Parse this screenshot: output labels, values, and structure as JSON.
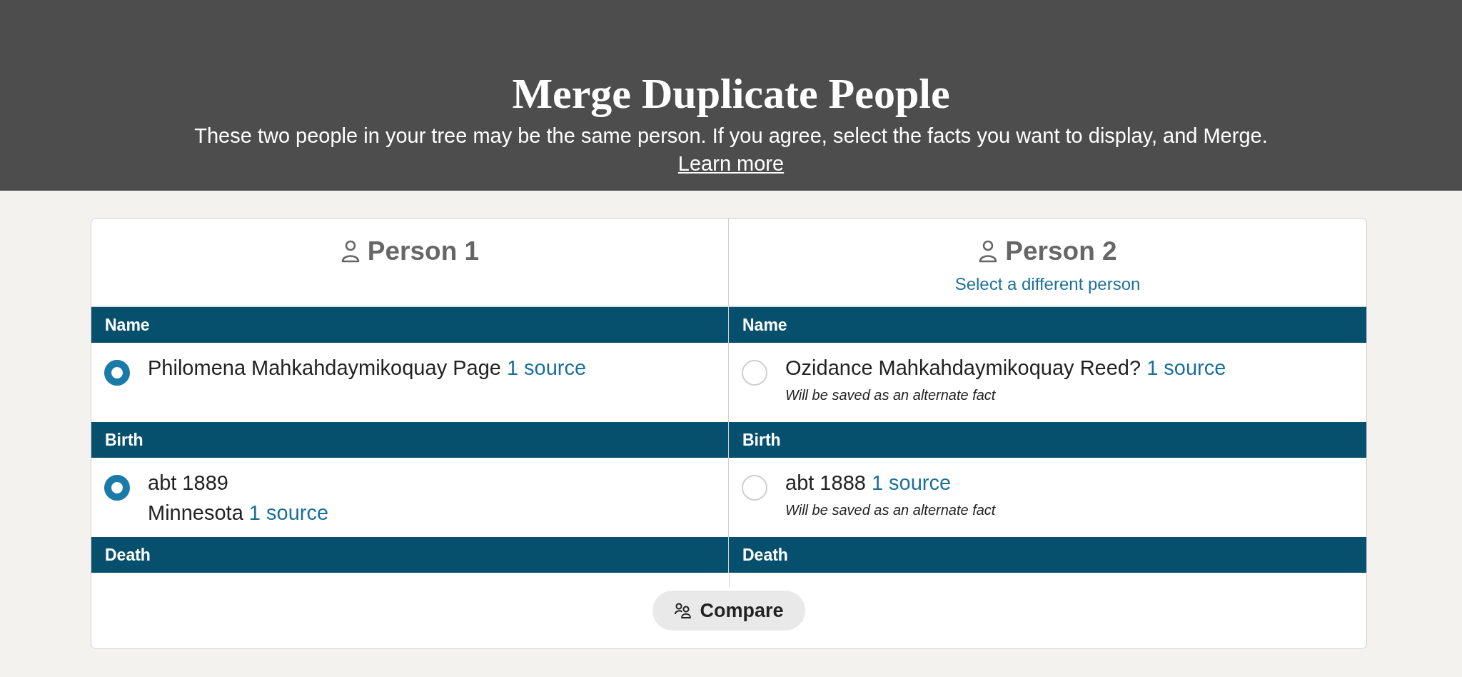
{
  "header": {
    "title": "Merge Duplicate People",
    "subtitle": "These two people in your tree may be the same person. If you agree, select the facts you want to display, and Merge.",
    "link": "Learn more"
  },
  "persons": [
    {
      "title": "Person 1"
    },
    {
      "title": "Person 2",
      "link": "Select a different person"
    }
  ],
  "sections": [
    {
      "headers": [
        "Name",
        "Name"
      ],
      "options": [
        {
          "lines": [
            "Philomena Mahkahdaymikoquay Page"
          ],
          "source": "1 source",
          "selected": true
        },
        {
          "lines": [
            "Ozidance Mahkahdaymikoquay Reed?"
          ],
          "source": "1 source",
          "selected": false,
          "note": "Will be saved as an alternate fact"
        }
      ]
    },
    {
      "headers": [
        "Birth",
        "Birth"
      ],
      "options": [
        {
          "lines": [
            "abt 1889",
            "Minnesota"
          ],
          "source": "1 source",
          "selected": true
        },
        {
          "lines": [
            "abt 1888"
          ],
          "source": "1 source",
          "selected": false,
          "note": "Will be saved as an alternate fact"
        }
      ]
    },
    {
      "headers": [
        "Death",
        "Death"
      ]
    }
  ],
  "compare_button": "Compare"
}
